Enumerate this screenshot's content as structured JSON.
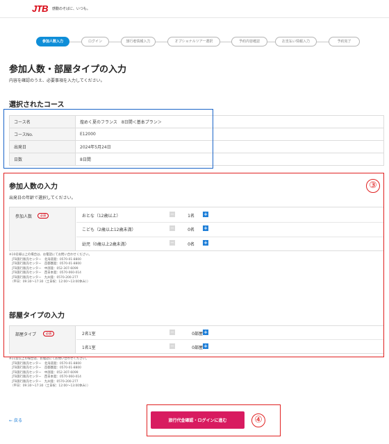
{
  "header": {
    "logo": "JTB",
    "tagline": "感動のそばに、いつも。"
  },
  "steps": [
    "参加人数入力",
    "ログイン",
    "旅行者情報入力",
    "オプショナルツアー選択",
    "予約内容確認",
    "お支払い情報入力",
    "予約完了"
  ],
  "page": {
    "title": "参加人数・部屋タイプの入力",
    "lead": "内容を確認のうえ、必要事項を入力してください。"
  },
  "course": {
    "title": "選択されたコース",
    "rows": [
      {
        "key": "コース名",
        "value": "煌めく夏のフランス　8日間＜基本プラン＞"
      },
      {
        "key": "コースNo.",
        "value": "E12000"
      },
      {
        "key": "出発日",
        "value": "2024年5月24日"
      },
      {
        "key": "日数",
        "value": "8日間"
      }
    ]
  },
  "participants": {
    "title": "参加人数の入力",
    "lead": "出発日の年齢で選択してください。",
    "label": "参加人数",
    "required": "必須",
    "rows": [
      {
        "label": "おとな（12歳以上）",
        "count": "1名"
      },
      {
        "label": "こども（2歳以上12歳未満）",
        "count": "0名"
      },
      {
        "label": "幼児（0歳以上2歳未満）",
        "count": "0名"
      }
    ],
    "note": "※10名様以上の場合は、お電話にてお問い合わせください。\n　JTB旅行販売センター　北海道発：0570-01-8800\n　JTB旅行販売センター　首都圏発：0570-01-8800\n　JTB旅行販売センター　中部発：052-307-6099\n　JTB旅行販売センター　西日本発：0570-060-014\n　JTB旅行販売センター　九州発：0570-200-277\n　（平日：09:30～17:30（土日祝：12:00～13:00休み））"
  },
  "rooms": {
    "title": "部屋タイプの入力",
    "label": "部屋タイプ",
    "required": "必須",
    "rows": [
      {
        "label": "2名1室",
        "count": "0部屋"
      },
      {
        "label": "1名1室",
        "count": "0部屋"
      }
    ],
    "note": "※11室以上の場合は、お電話にてお問い合わせください。\n　JTB旅行販売センター　北海道発：0570-01-8800\n　JTB旅行販売センター　首都圏発：0570-01-8800\n　JTB旅行販売センター　中部発：052-307-6099\n　JTB旅行販売センター　西日本発：0570-060-014\n　JTB旅行販売センター　九州発：0570-200-277\n　（平日：09:30～17:30（土日祝：12:00～13:00休み））"
  },
  "annotations": {
    "three": "③",
    "four": "④"
  },
  "footer": {
    "back": "戻る",
    "next": "旅行代金確認・ログインに進む"
  },
  "icons": {
    "back": "arrow-left-icon",
    "plus": "plus-icon",
    "minus": "minus-icon"
  },
  "colors": {
    "brand": "#d7000f",
    "accent": "#0f8ed8",
    "cta": "#d81b60"
  }
}
